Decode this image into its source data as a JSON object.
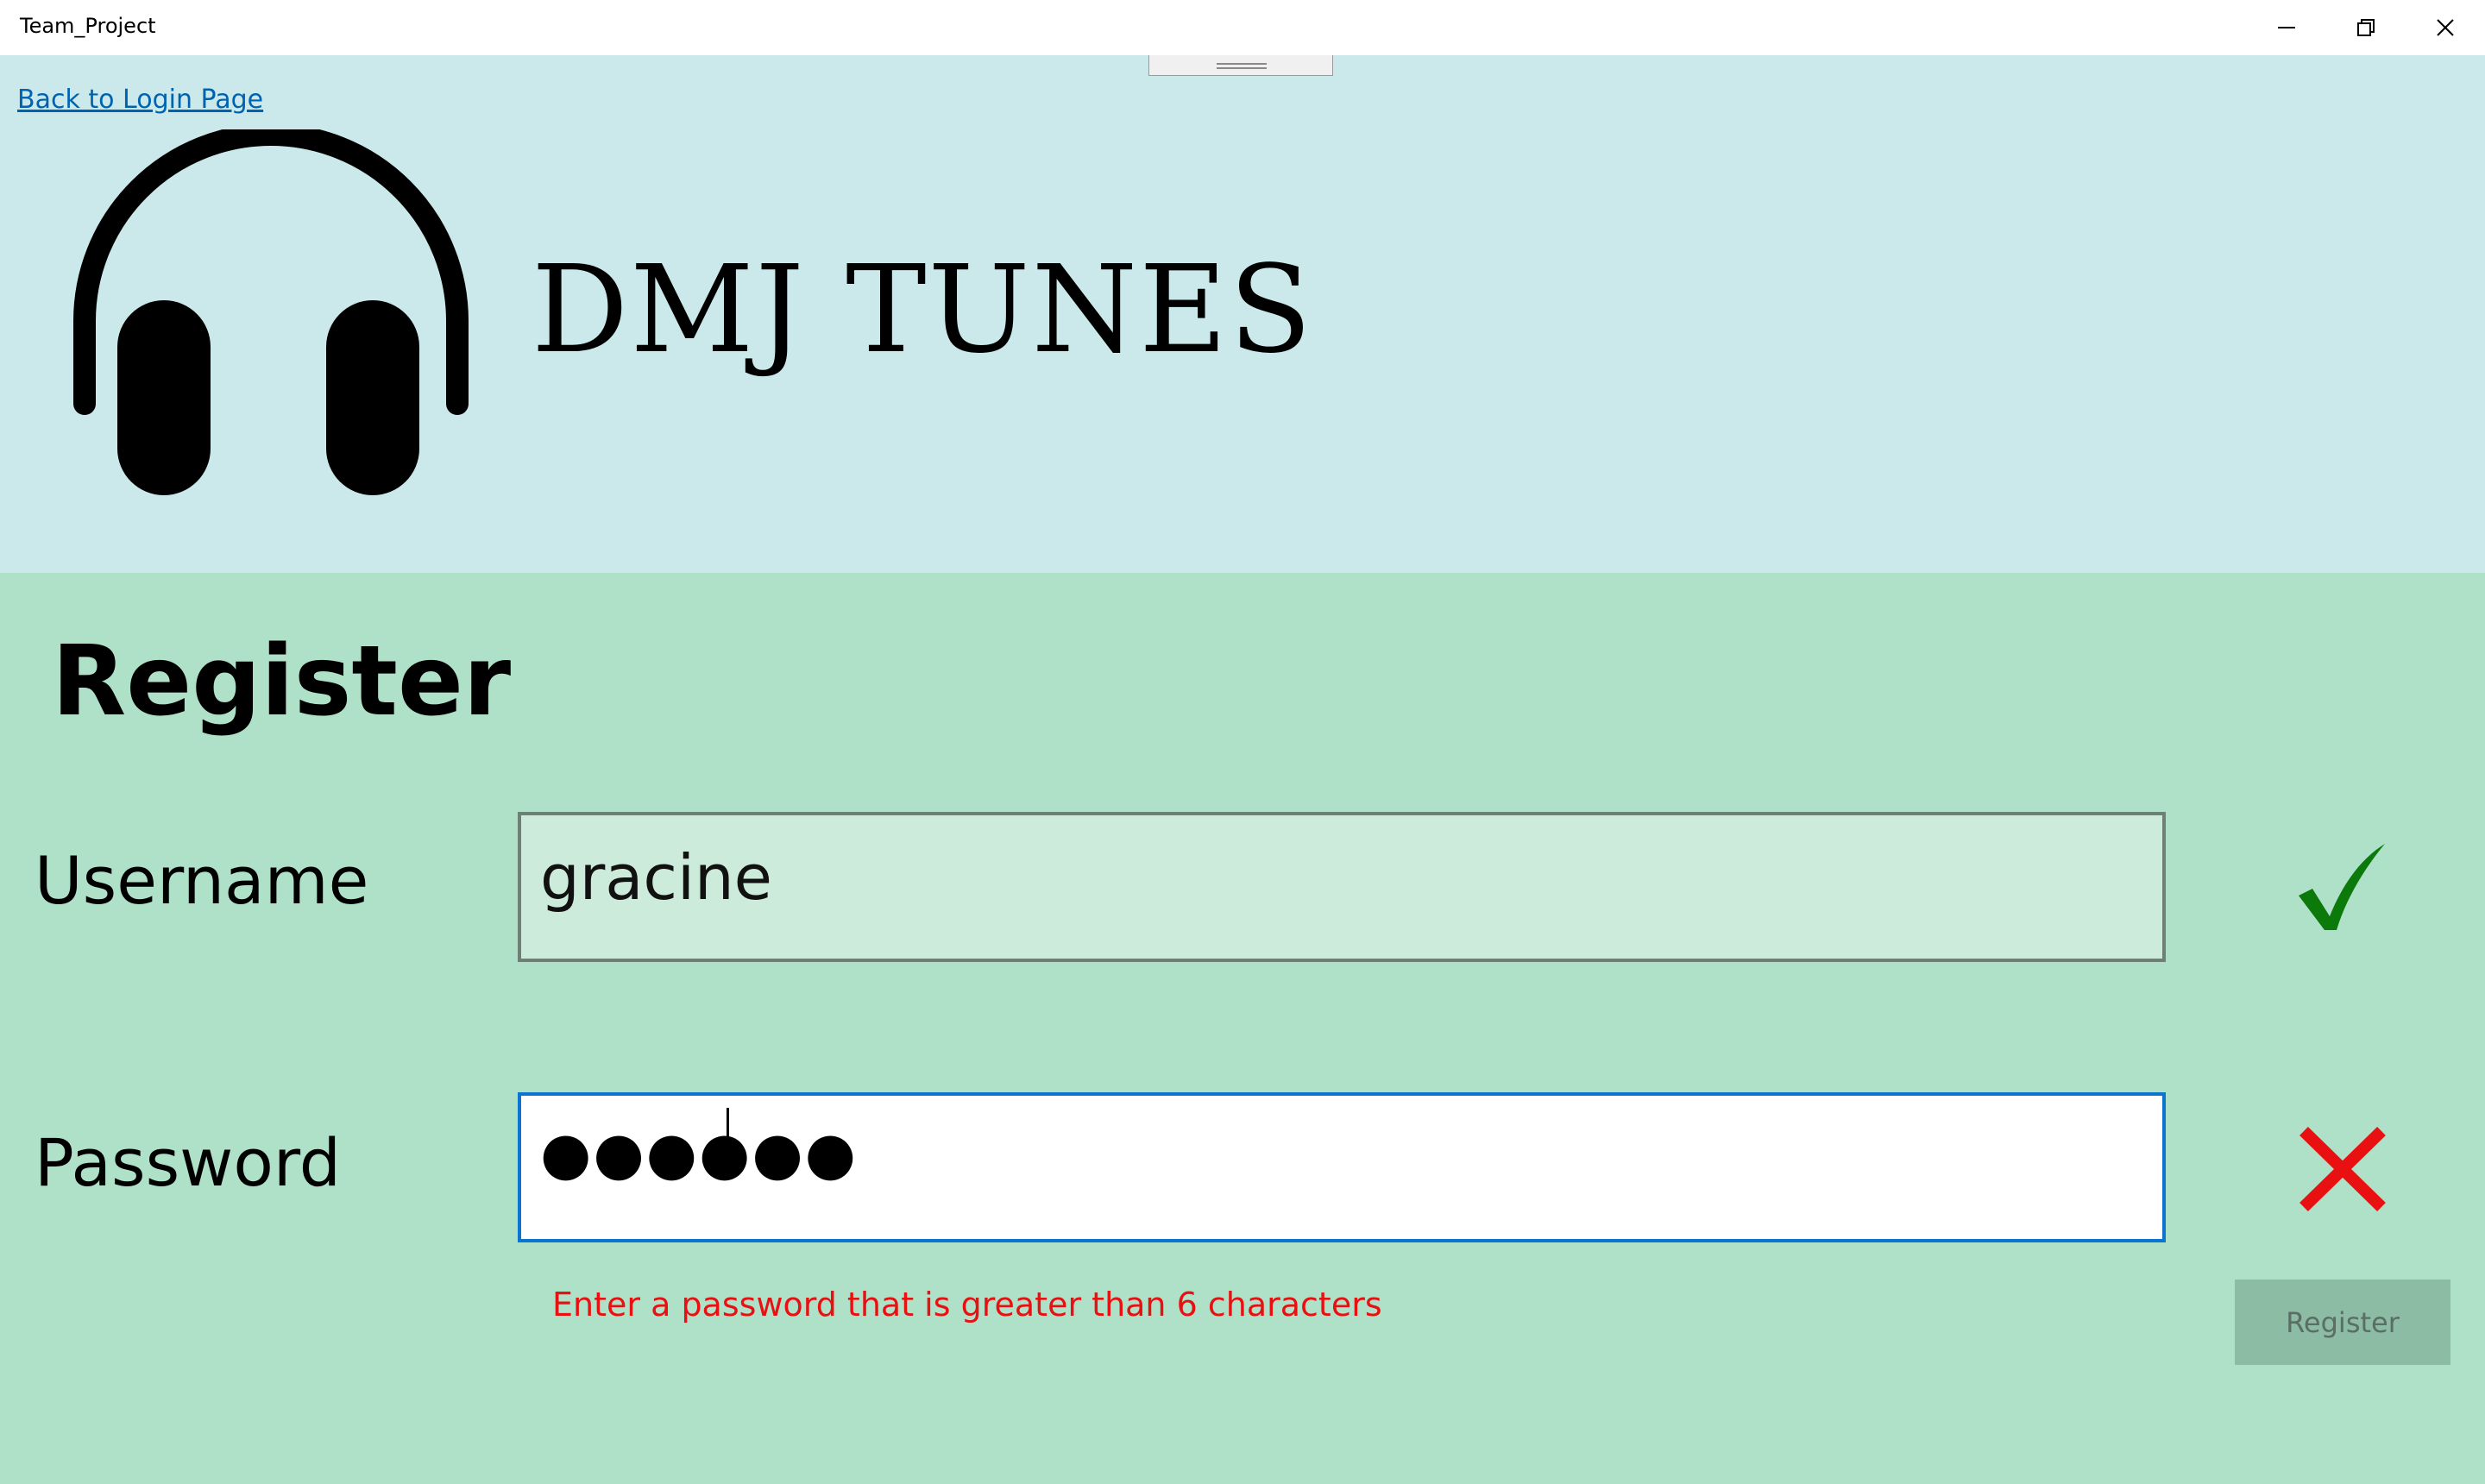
{
  "window": {
    "title": "Team_Project",
    "controls": [
      "minimize-icon",
      "restore-icon",
      "close-icon"
    ]
  },
  "header": {
    "back_link": "Back to Login Page",
    "logo_icon": "headphones-icon",
    "brand_name": "DMJ TUNES",
    "background_color": "#cbe9ea"
  },
  "form": {
    "heading": "Register",
    "username": {
      "label": "Username",
      "value": "gracine",
      "status_icon": "check-icon",
      "status_color": "#0b7a0b"
    },
    "password": {
      "label": "Password",
      "masked_value": "●●●●●●",
      "status_icon": "x-icon",
      "status_color": "#e81010",
      "error": "Enter a password that is greater than 6 characters"
    },
    "register_label": "Register",
    "background_color": "#afe0c8"
  }
}
